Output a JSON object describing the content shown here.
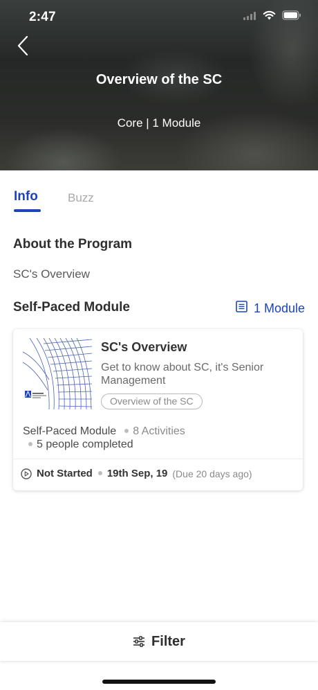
{
  "status_bar": {
    "time": "2:47"
  },
  "header": {
    "title": "Overview of the SC",
    "subtitle": "Core | 1 Module"
  },
  "tabs": [
    {
      "label": "Info",
      "active": true
    },
    {
      "label": "Buzz",
      "active": false
    }
  ],
  "about": {
    "heading": "About the Program",
    "text": "SC's Overview"
  },
  "module_section": {
    "heading": "Self-Paced Module",
    "count_label": "1 Module"
  },
  "module_card": {
    "title": "SC's Overview",
    "description": "Get to know about SC, it's Senior Management",
    "tag": "Overview of the SC",
    "type": "Self-Paced Module",
    "activities": "8 Activities",
    "completed": "5 people completed",
    "status": "Not Started",
    "date": "19th Sep, 19",
    "due": "(Due 20 days ago)"
  },
  "bottom_bar": {
    "filter_label": "Filter"
  },
  "colors": {
    "accent": "#1c44b8",
    "text": "#2e2e2e",
    "muted": "#8a8a8a"
  },
  "icons": [
    "back-icon",
    "signal-icon",
    "wifi-icon",
    "battery-icon",
    "list-icon",
    "play-circle-icon",
    "sliders-icon"
  ]
}
